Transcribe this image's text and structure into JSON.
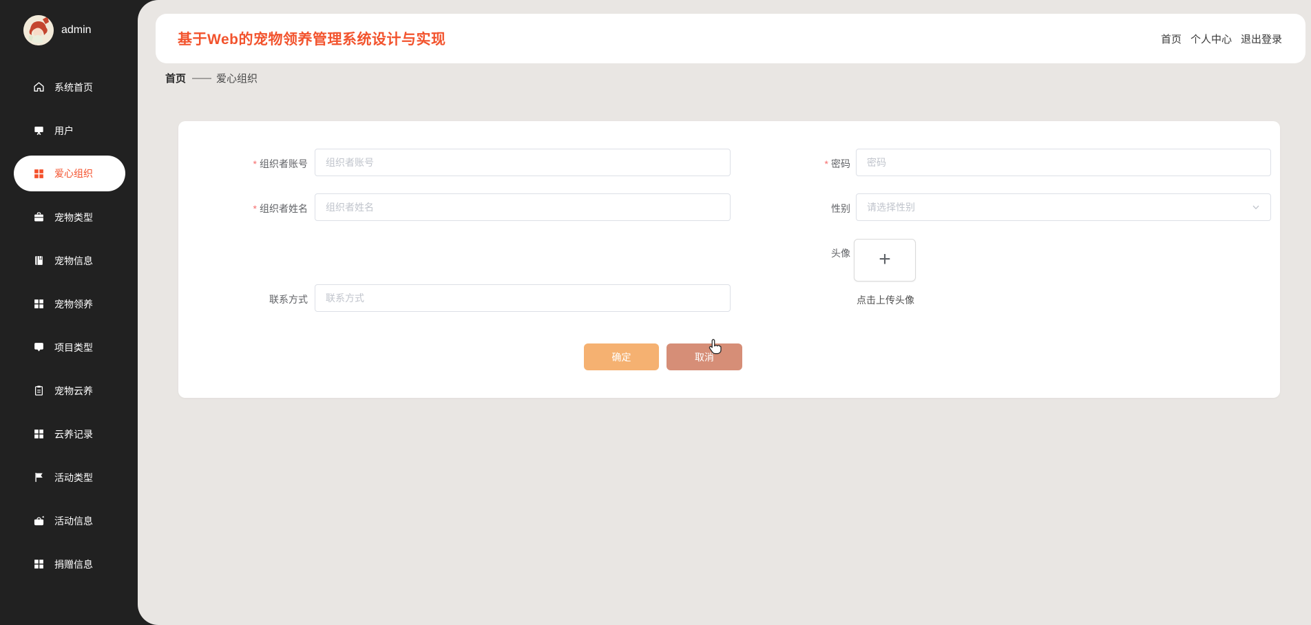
{
  "user": {
    "name": "admin"
  },
  "sidebar": {
    "items": [
      {
        "label": "系统首页",
        "icon": "home-icon",
        "active": false
      },
      {
        "label": "用户",
        "icon": "monitor-icon",
        "active": false
      },
      {
        "label": "爱心组织",
        "icon": "grid-icon",
        "active": true
      },
      {
        "label": "宠物类型",
        "icon": "suitcase-icon",
        "active": false
      },
      {
        "label": "宠物信息",
        "icon": "notebook-icon",
        "active": false
      },
      {
        "label": "宠物领养",
        "icon": "grid-icon",
        "active": false
      },
      {
        "label": "项目类型",
        "icon": "chat-icon",
        "active": false
      },
      {
        "label": "宠物云养",
        "icon": "clipboard-icon",
        "active": false
      },
      {
        "label": "云养记录",
        "icon": "grid-icon",
        "active": false
      },
      {
        "label": "活动类型",
        "icon": "flag-icon",
        "active": false
      },
      {
        "label": "活动信息",
        "icon": "bag-icon",
        "active": false
      },
      {
        "label": "捐赠信息",
        "icon": "grid-icon",
        "active": false
      }
    ]
  },
  "header": {
    "title": "基于Web的宠物领养管理系统设计与实现",
    "nav": [
      {
        "label": "首页"
      },
      {
        "label": "个人中心"
      },
      {
        "label": "退出登录"
      }
    ]
  },
  "breadcrumb": {
    "root": "首页",
    "separator": "——",
    "current": "爱心组织"
  },
  "form": {
    "fields": {
      "account": {
        "label": "组织者账号",
        "placeholder": "组织者账号",
        "required": "*",
        "value": ""
      },
      "password": {
        "label": "密码",
        "placeholder": "密码",
        "required": "*",
        "value": ""
      },
      "name": {
        "label": "组织者姓名",
        "placeholder": "组织者姓名",
        "required": "*",
        "value": ""
      },
      "gender": {
        "label": "性别",
        "placeholder": "请选择性别"
      },
      "avatar": {
        "label": "头像",
        "hint": "点击上传头像",
        "plus": "+"
      },
      "contact": {
        "label": "联系方式",
        "placeholder": "联系方式",
        "value": ""
      }
    },
    "buttons": {
      "confirm": "确定",
      "cancel": "取消"
    }
  },
  "colors": {
    "accent": "#f2532d",
    "active_item": "#f4512c",
    "confirm_button": "#f5b171",
    "cancel_button": "#d68e77",
    "sidebar_bg": "#212121",
    "main_bg": "#e9e6e3",
    "input_border": "#dcdfe6",
    "placeholder": "#c0c4cc",
    "required_mark": "#f56c6c"
  }
}
